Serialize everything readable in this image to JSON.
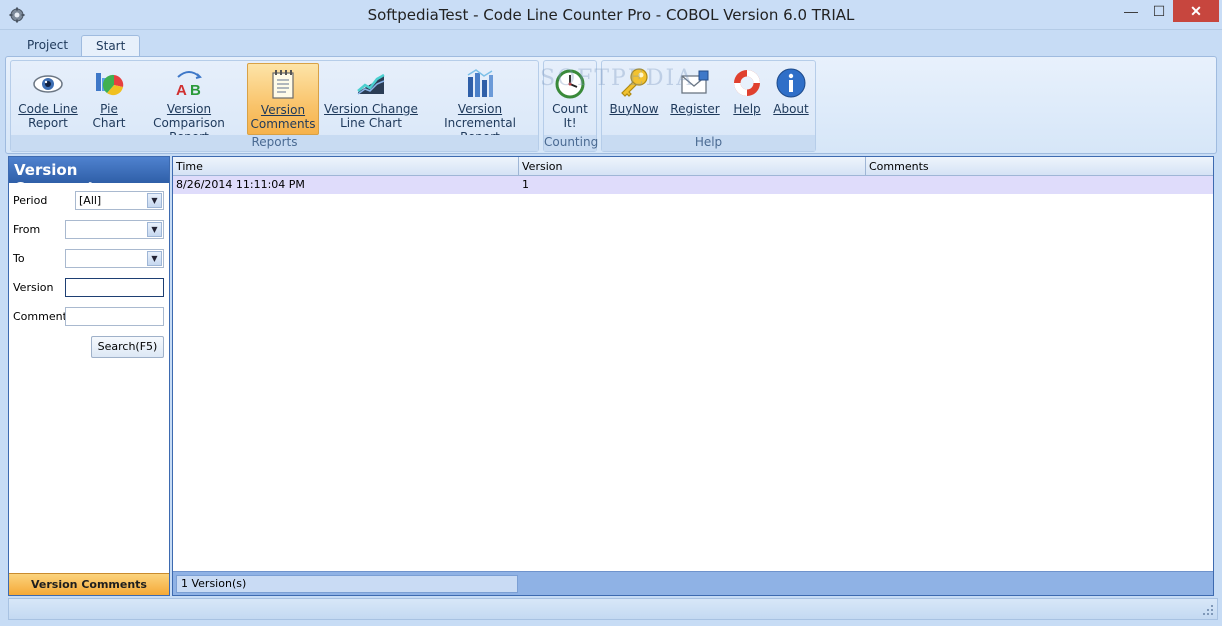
{
  "window": {
    "title": "SoftpediaTest - Code Line Counter Pro - COBOL Version 6.0 TRIAL",
    "buttons": {
      "minimize": "—",
      "maximize": "☐",
      "close": "✕"
    }
  },
  "ribbon": {
    "tabs": [
      {
        "label": "Project"
      },
      {
        "label": "Start",
        "selected": true
      }
    ],
    "groups": {
      "reports": {
        "label": "Reports",
        "buttons": [
          {
            "line1": "Code Line",
            "line2": "Report",
            "icon": "eye-icon"
          },
          {
            "line1": "Pie",
            "line2": "Chart",
            "icon": "pie-chart-icon"
          },
          {
            "line1": "Version",
            "line2": "Comparison Report",
            "icon": "ab-compare-icon"
          },
          {
            "line1": "Version",
            "line2": "Comments",
            "icon": "notepad-icon",
            "active": true
          },
          {
            "line1": "Version Change",
            "line2": "Line Chart",
            "icon": "line-chart-icon"
          },
          {
            "line1": "Version",
            "line2": "Incremental Report",
            "icon": "bar-chart-icon"
          }
        ]
      },
      "counting": {
        "label": "Counting",
        "buttons": [
          {
            "line1": "Count",
            "line2": "It!",
            "icon": "clock-icon"
          }
        ]
      },
      "help": {
        "label": "Help",
        "buttons": [
          {
            "line1": "BuyNow",
            "icon": "key-icon"
          },
          {
            "line1": "Register",
            "icon": "envelope-icon"
          },
          {
            "line1": "Help",
            "icon": "lifebuoy-icon"
          },
          {
            "line1": "About",
            "icon": "info-icon"
          }
        ]
      }
    }
  },
  "watermark": "SOFTPEDIA",
  "left_panel": {
    "title": "Version Comments",
    "fields": {
      "period": {
        "label": "Period",
        "value": "[All]"
      },
      "from": {
        "label": "From",
        "value": ""
      },
      "to": {
        "label": "To",
        "value": ""
      },
      "version": {
        "label": "Version",
        "value": ""
      },
      "comments": {
        "label": "Comments",
        "value": ""
      }
    },
    "search_button": "Search(F5)",
    "footer": "Version Comments"
  },
  "grid": {
    "columns": [
      "Time",
      "Version",
      "Comments"
    ],
    "rows": [
      {
        "time": "8/26/2014 11:11:04 PM",
        "version": "1",
        "comments": ""
      }
    ],
    "footer_count": "1 Version(s)"
  },
  "colors": {
    "accent": "#2f5fa8",
    "active_button": "#f9c36a",
    "selected_row": "#dfdcfb",
    "close_button": "#c7463e"
  }
}
